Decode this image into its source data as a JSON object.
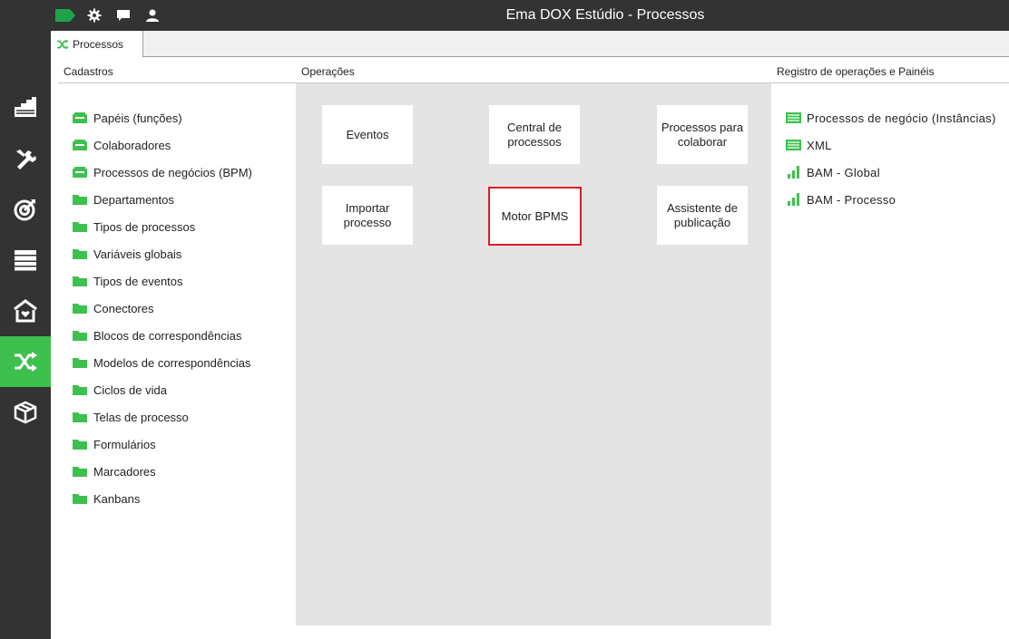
{
  "window": {
    "title": "Ema DOX Estúdio - Processos"
  },
  "titlebar_icons": [
    "tag-icon",
    "gear-icon",
    "chat-icon",
    "user-icon"
  ],
  "leftnav": {
    "items": [
      {
        "icon": "stairs-icon",
        "active": false
      },
      {
        "icon": "tools-icon",
        "active": false
      },
      {
        "icon": "target-icon",
        "active": false
      },
      {
        "icon": "storage-icon",
        "active": false
      },
      {
        "icon": "home-heart-icon",
        "active": false
      },
      {
        "icon": "shuffle-icon",
        "active": true
      },
      {
        "icon": "package-icon",
        "active": false
      }
    ]
  },
  "tab": {
    "label": "Processos",
    "icon": "shuffle-icon"
  },
  "sections": {
    "cadastros": "Cadastros",
    "operacoes": "Operações",
    "registro": "Registro de operações e Painéis"
  },
  "cadastros": [
    {
      "label": "Papéis (funções)",
      "icon": "tray-icon"
    },
    {
      "label": "Colaboradores",
      "icon": "tray-icon"
    },
    {
      "label": "Processos de negócios (BPM)",
      "icon": "tray-icon"
    },
    {
      "label": "Departamentos",
      "icon": "folder-icon"
    },
    {
      "label": "Tipos de processos",
      "icon": "folder-icon"
    },
    {
      "label": "Variáveis globais",
      "icon": "folder-icon"
    },
    {
      "label": "Tipos de eventos",
      "icon": "folder-icon"
    },
    {
      "label": "Conectores",
      "icon": "folder-icon"
    },
    {
      "label": "Blocos de correspondências",
      "icon": "folder-icon"
    },
    {
      "label": "Modelos de correspondências",
      "icon": "folder-icon"
    },
    {
      "label": "Ciclos de vida",
      "icon": "folder-icon"
    },
    {
      "label": "Telas de processo",
      "icon": "folder-icon"
    },
    {
      "label": "Formulários",
      "icon": "folder-icon"
    },
    {
      "label": "Marcadores",
      "icon": "folder-icon"
    },
    {
      "label": "Kanbans",
      "icon": "folder-icon"
    }
  ],
  "operacoes": [
    {
      "label": "Eventos",
      "selected": false
    },
    {
      "label": "Central de processos",
      "selected": false
    },
    {
      "label": "Processos para colaborar",
      "selected": false
    },
    {
      "label": "Importar processo",
      "selected": false
    },
    {
      "label": "Motor BPMS",
      "selected": true
    },
    {
      "label": "Assistente de publicação",
      "selected": false
    }
  ],
  "registro": [
    {
      "label": "Processos de negócio (Instâncias)",
      "icon": "list-icon"
    },
    {
      "label": "XML",
      "icon": "list-icon"
    },
    {
      "label": "BAM - Global",
      "icon": "bar-chart-icon"
    },
    {
      "label": "BAM - Processo",
      "icon": "bar-chart-icon"
    }
  ],
  "colors": {
    "accent": "#3ec04f",
    "dark": "#333333",
    "selection": "#e01a22",
    "panel": "#e4e4e4"
  }
}
